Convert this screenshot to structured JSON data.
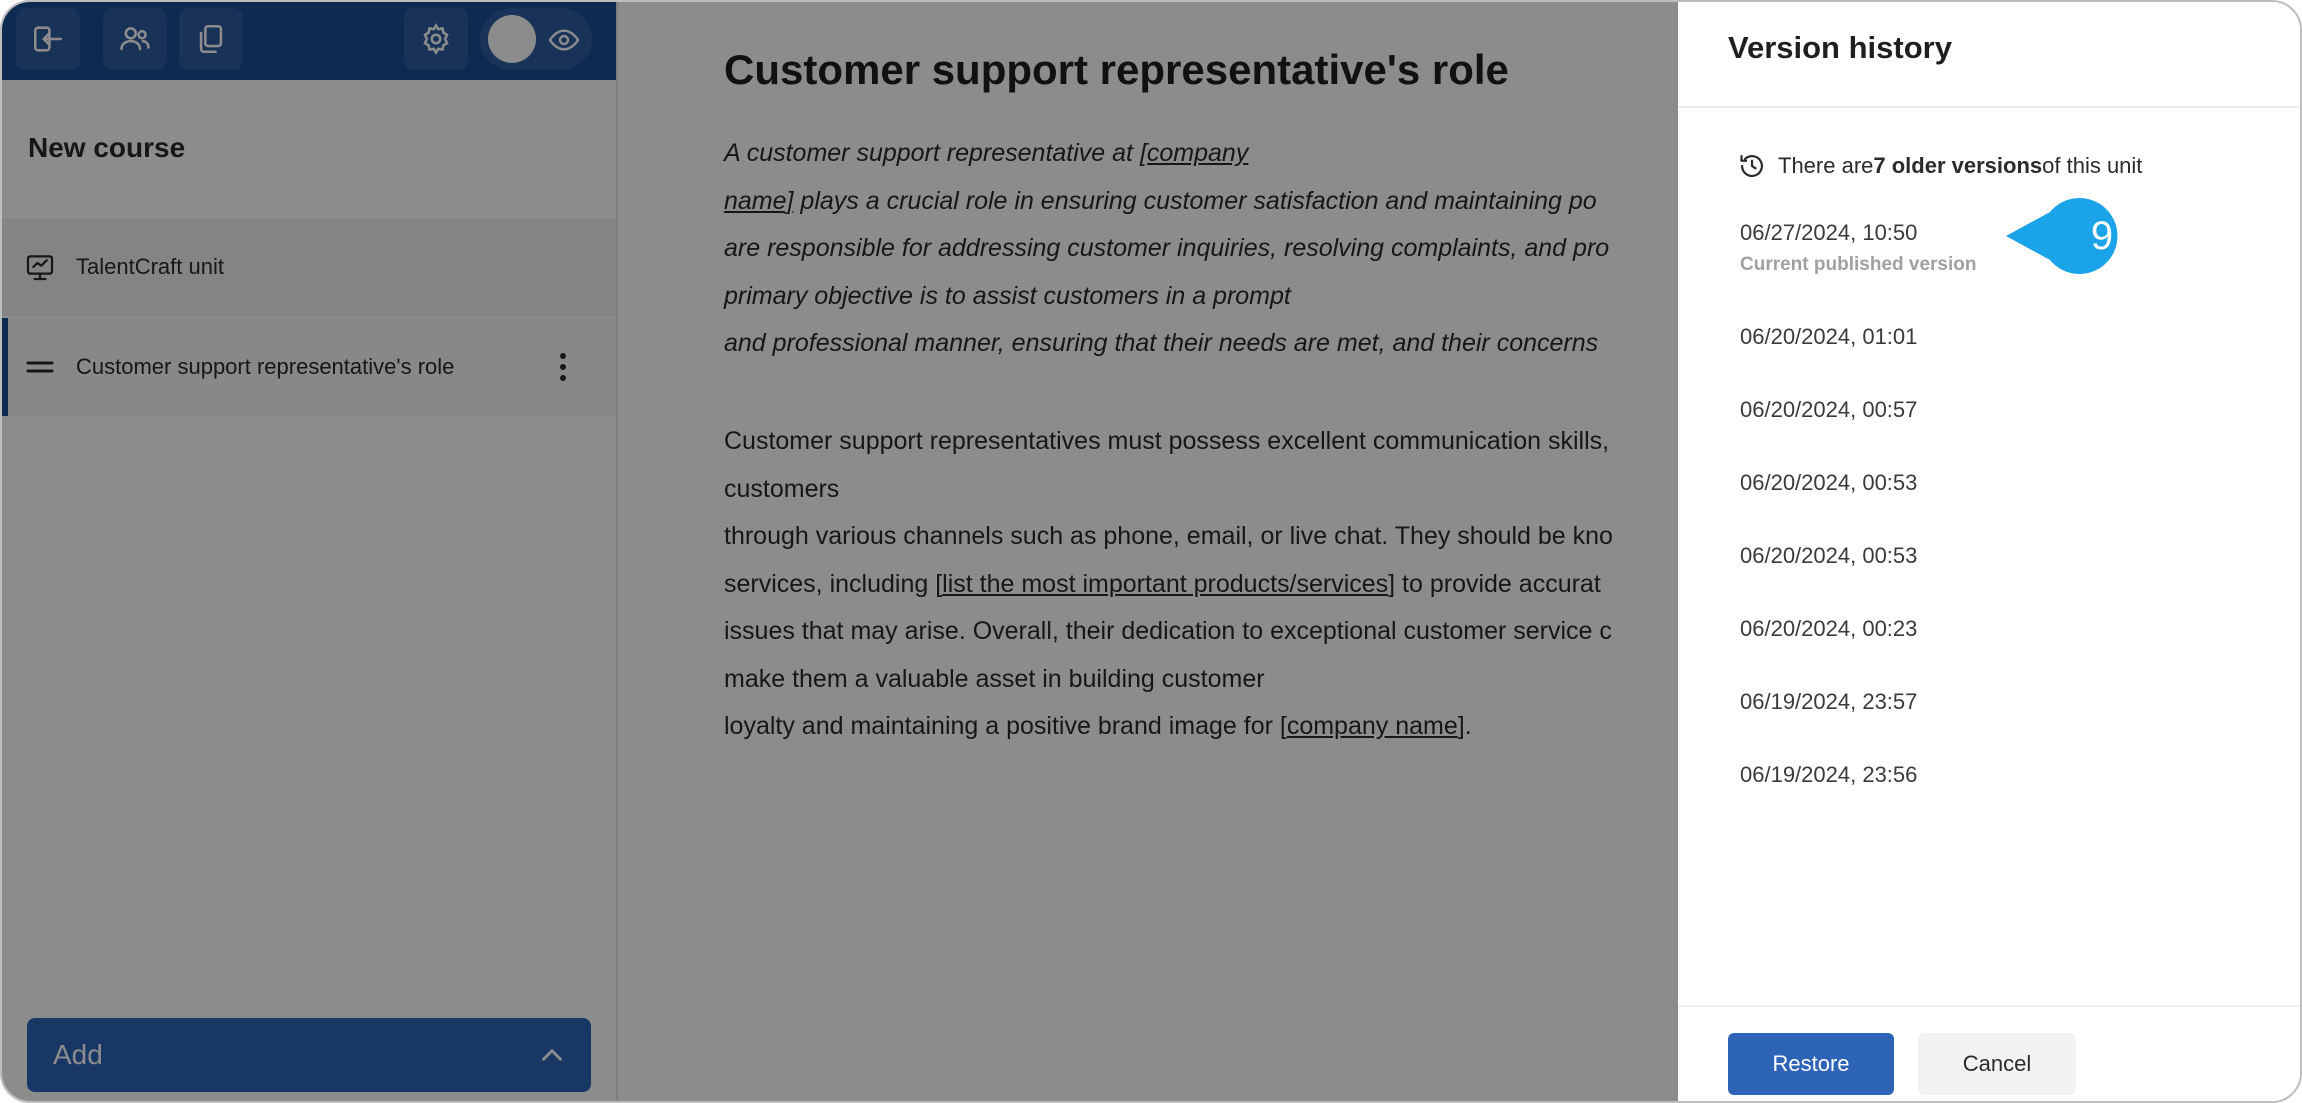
{
  "sidebar": {
    "course_title": "New course",
    "items": [
      {
        "label": "TalentCraft unit",
        "icon": "unit-icon"
      },
      {
        "label": "Customer support representative's role",
        "icon": "drag-handle-icon"
      }
    ],
    "add_label": "Add"
  },
  "main": {
    "title": "Customer support representative's role",
    "para1_lines": [
      {
        "a": "A customer support representative at ",
        "b": "[company"
      },
      {
        "a": "name]",
        "b": " plays a crucial role in ensuring customer satisfaction and maintaining po"
      },
      {
        "a": "are responsible for addressing customer inquiries, resolving complaints, and pro"
      },
      {
        "a": "primary objective is to assist customers in a prompt"
      },
      {
        "a": "and professional manner, ensuring that their needs are met, and their concerns"
      }
    ],
    "para2_lines": [
      {
        "a": "Customer support representatives must possess excellent communication skills,"
      },
      {
        "a": "customers"
      },
      {
        "a": "through various channels such as phone, email, or live chat. They should be kno"
      },
      {
        "a": "services, including [",
        "u": "list the most important products/services",
        "c": "] to provide accurat"
      },
      {
        "a": "issues that may arise. Overall, their dedication to exceptional customer service c"
      },
      {
        "a": "make them a valuable asset in building customer"
      },
      {
        "a": "loyalty and maintaining a positive brand image for [",
        "u": "company name",
        "c": "]."
      }
    ]
  },
  "panel": {
    "title": "Version history",
    "info_prefix": "There are ",
    "info_bold": "7 older versions",
    "info_suffix": " of this unit",
    "current_label": "Current published version",
    "versions": [
      "06/27/2024, 10:50",
      "06/20/2024, 01:01",
      "06/20/2024, 00:57",
      "06/20/2024, 00:53",
      "06/20/2024, 00:53",
      "06/20/2024, 00:23",
      "06/19/2024, 23:57",
      "06/19/2024, 23:56"
    ],
    "restore_label": "Restore",
    "cancel_label": "Cancel"
  },
  "marker": {
    "number": "9",
    "color": "#1aa3e8"
  },
  "colors": {
    "brand": "#1c4e96",
    "button": "#2e64b8",
    "overlay": "rgba(0,0,0,0.45)"
  }
}
